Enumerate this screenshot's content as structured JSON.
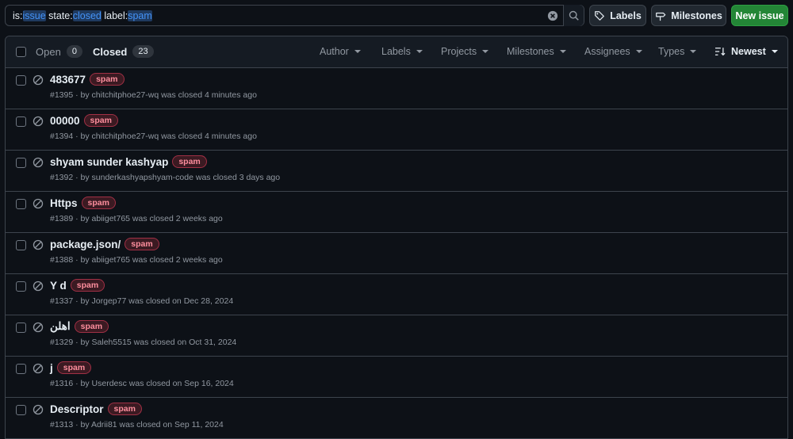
{
  "search": {
    "parts": [
      {
        "t": "is:",
        "q": false
      },
      {
        "t": "issue",
        "q": true
      },
      {
        "t": " state:",
        "q": false
      },
      {
        "t": "closed",
        "q": true
      },
      {
        "t": " label:",
        "q": false
      },
      {
        "t": "spam",
        "q": true
      }
    ]
  },
  "toolbar": {
    "labels_label": "Labels",
    "milestones_label": "Milestones",
    "new_issue_label": "New issue"
  },
  "header": {
    "open_label": "Open",
    "open_count": "0",
    "closed_label": "Closed",
    "closed_count": "23",
    "filters": [
      "Author",
      "Labels",
      "Projects",
      "Milestones",
      "Assignees",
      "Types"
    ],
    "sort_label": "Newest"
  },
  "issues": [
    {
      "title": "483677",
      "label": "spam",
      "meta": "#1395 · by chitchitphoe27-wq was closed 4 minutes ago"
    },
    {
      "title": "00000",
      "label": "spam",
      "meta": "#1394 · by chitchitphoe27-wq was closed 4 minutes ago"
    },
    {
      "title": "shyam sunder kashyap",
      "label": "spam",
      "meta": "#1392 · by sunderkashyapshyam-code was closed 3 days ago"
    },
    {
      "title": "Https",
      "label": "spam",
      "meta": "#1389 · by abiiget765 was closed 2 weeks ago"
    },
    {
      "title": "package.json/",
      "label": "spam",
      "meta": "#1388 · by abiiget765 was closed 2 weeks ago"
    },
    {
      "title": "Y d",
      "label": "spam",
      "meta": "#1337 · by Jorgep77 was closed on Dec 28, 2024"
    },
    {
      "title": "اهلن",
      "label": "spam",
      "meta": "#1329 · by Saleh5515 was closed on Oct 31, 2024"
    },
    {
      "title": "j",
      "label": "spam",
      "meta": "#1316 · by Userdesc was closed on Sep 16, 2024"
    },
    {
      "title": "Descriptor",
      "label": "spam",
      "meta": "#1313 · by Adrii81 was closed on Sep 11, 2024"
    }
  ]
}
